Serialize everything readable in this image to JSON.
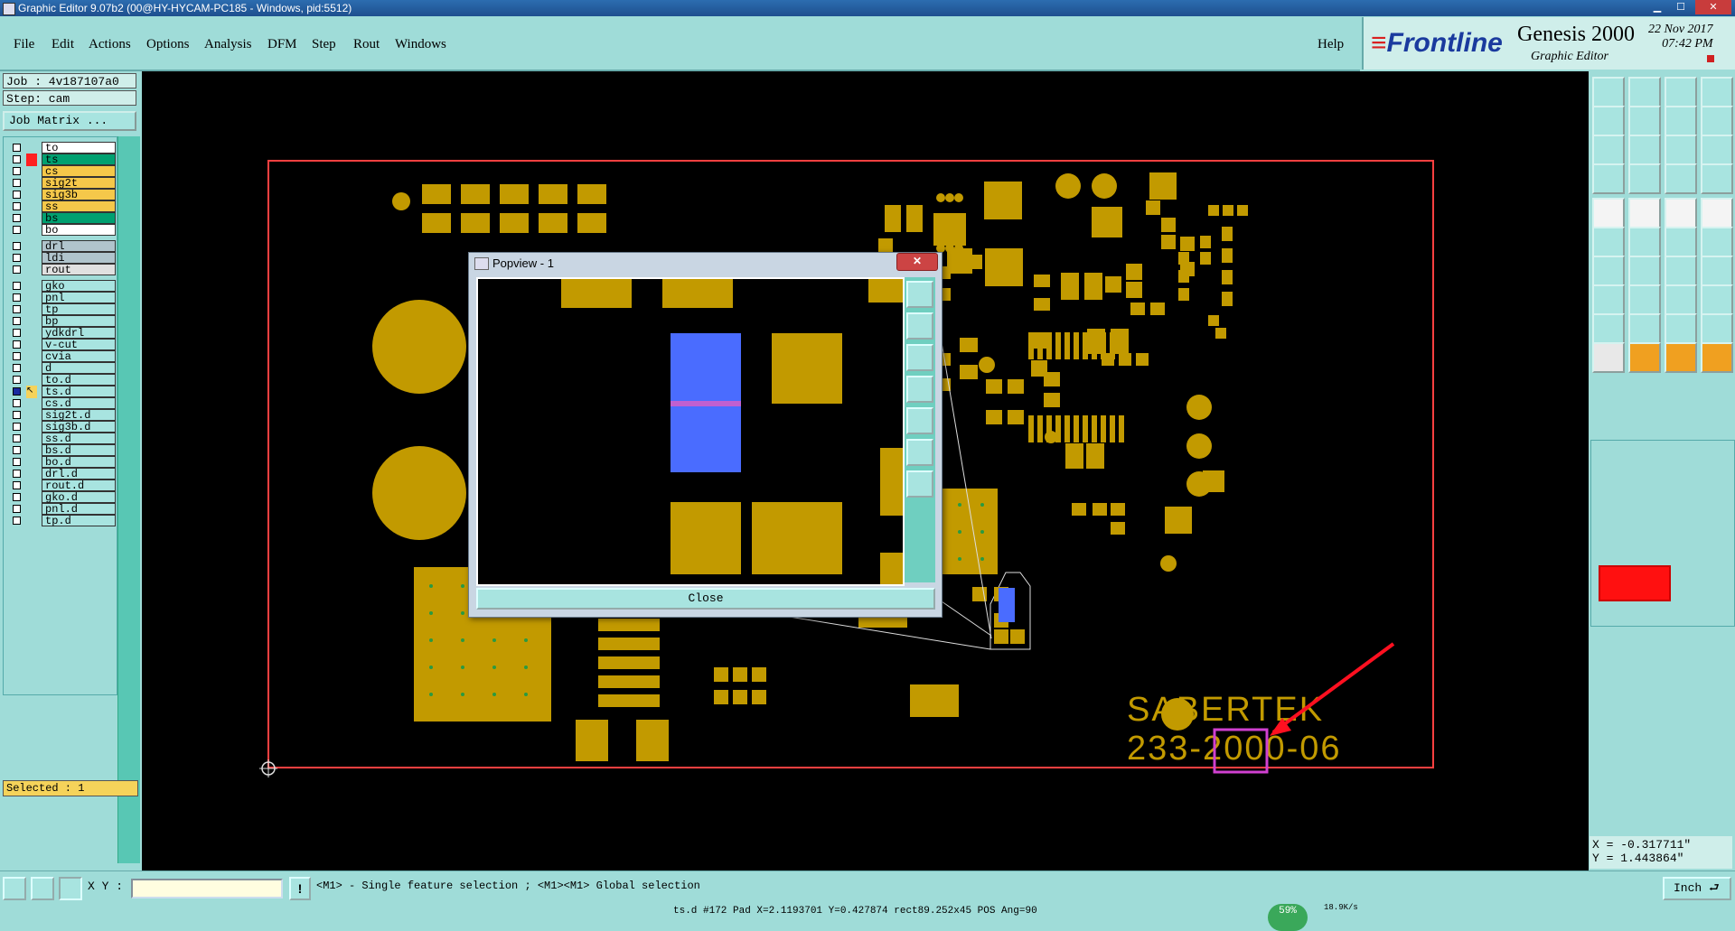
{
  "window": {
    "title": "Graphic Editor 9.07b2 (00@HY-HYCAM-PC185 - Windows, pid:5512)"
  },
  "menu": [
    "File",
    "Edit",
    "Actions",
    "Options",
    "Analysis",
    "DFM",
    "Step",
    "Rout",
    "Windows"
  ],
  "help": "Help",
  "brand": {
    "logo": "Frontline",
    "product": "Genesis 2000",
    "subtitle": "Graphic Editor",
    "date": "22 Nov 2017",
    "time": "07:42 PM"
  },
  "job": {
    "job_label": "Job : 4v187107a0",
    "step_label": "Step: cam",
    "matrix_button": "Job Matrix ..."
  },
  "layers": [
    {
      "name": "to",
      "color": "#ffffff",
      "active": false
    },
    {
      "name": "ts",
      "color": "#00a070",
      "active": true,
      "marker": "#ff2020"
    },
    {
      "name": "cs",
      "color": "#f5c84a"
    },
    {
      "name": "sig2t",
      "color": "#f5c84a"
    },
    {
      "name": "sig3b",
      "color": "#f5c84a"
    },
    {
      "name": "ss",
      "color": "#f5c84a"
    },
    {
      "name": "bs",
      "color": "#00a070"
    },
    {
      "name": "bo",
      "color": "#ffffff"
    },
    {
      "name": "drl",
      "color": "#b0c4cc"
    },
    {
      "name": "ldi",
      "color": "#b0c4cc"
    },
    {
      "name": "rout",
      "color": "#e0e0e0"
    },
    {
      "name": "gko",
      "color": "#a8e4e0"
    },
    {
      "name": "pnl",
      "color": "#a8e4e0"
    },
    {
      "name": "tp",
      "color": "#a8e4e0"
    },
    {
      "name": "bp",
      "color": "#a8e4e0"
    },
    {
      "name": "ydkdrl",
      "color": "#a8e4e0"
    },
    {
      "name": "v-cut",
      "color": "#a8e4e0"
    },
    {
      "name": "cvia",
      "color": "#a8e4e0"
    },
    {
      "name": "d",
      "color": "#a8e4e0"
    },
    {
      "name": "to.d",
      "color": "#a8e4e0"
    },
    {
      "name": "ts.d",
      "color": "#a8e4e0",
      "work": true
    },
    {
      "name": "cs.d",
      "color": "#a8e4e0"
    },
    {
      "name": "sig2t.d",
      "color": "#a8e4e0"
    },
    {
      "name": "sig3b.d",
      "color": "#a8e4e0"
    },
    {
      "name": "ss.d",
      "color": "#a8e4e0"
    },
    {
      "name": "bs.d",
      "color": "#a8e4e0"
    },
    {
      "name": "bo.d",
      "color": "#a8e4e0"
    },
    {
      "name": "drl.d",
      "color": "#a8e4e0"
    },
    {
      "name": "rout.d",
      "color": "#a8e4e0"
    },
    {
      "name": "gko.d",
      "color": "#a8e4e0"
    },
    {
      "name": "pnl.d",
      "color": "#a8e4e0"
    },
    {
      "name": "tp.d",
      "color": "#a8e4e0"
    }
  ],
  "selected": "Selected : 1",
  "board_text": {
    "line1": "SABERTEK",
    "line2": "233-2000-06"
  },
  "popview": {
    "title": "Popview - 1",
    "close_x": "✕",
    "close_button": "Close"
  },
  "coords": {
    "x": "X = -0.317711\"",
    "y": "Y = 1.443864\""
  },
  "bottom": {
    "xy_label": "X Y :",
    "xy_value": "",
    "prompt": "<M1> - Single feature selection ; <M1><M1> Global selection",
    "unit": "Inch"
  },
  "status": {
    "line": "ts.d #172 Pad X=2.1193701 Y=0.427874 rect89.252x45 POS Ang=90",
    "percent": "59%",
    "net": "18.9K/s"
  },
  "colors": {
    "copper": "#c29a00",
    "board_outline": "#ff4040",
    "highlight": "#ff3040",
    "selection_box": "#d040d0",
    "blue_pad": "#4a6cff"
  }
}
